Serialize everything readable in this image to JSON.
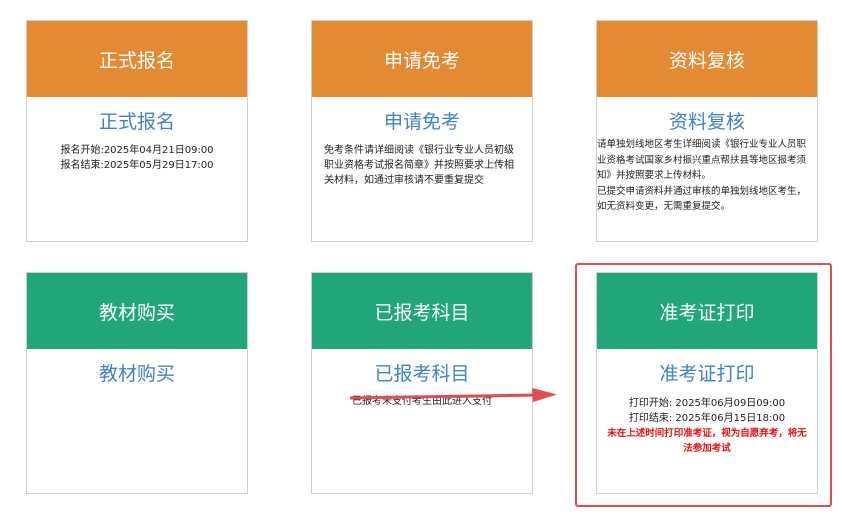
{
  "cards": {
    "formal_register": {
      "header": "正式报名",
      "link": "正式报名",
      "start": "报名开始:2025年04月21日09:00",
      "end": "报名结束:2025年05月29日17:00"
    },
    "apply_exempt": {
      "header": "申请免考",
      "link": "申请免考",
      "desc": "免考条件请详细阅读《银行业专业人员初级职业资格考试报名简章》并按照要求上传相关材料，如通过审核请不要重复提交"
    },
    "material_review": {
      "header": "资料复核",
      "link": "资料复核",
      "desc1": "请单独划线地区考生详细阅读《银行业专业人员职业资格考试国家乡村振兴重点帮扶县等地区报考须知》并按照要求上传材料。",
      "desc2": "已提交申请资料并通过审核的单独划线地区考生，如无资料变更，无需重复提交。"
    },
    "textbook_purchase": {
      "header": "教材购买",
      "link": "教材购买"
    },
    "registered_subjects": {
      "header": "已报考科目",
      "link": "已报考科目",
      "desc": "已报考未支付考生由此进入支付"
    },
    "admission_print": {
      "header": "准考证打印",
      "link": "准考证打印",
      "start": "打印开始:  2025年06月09日09:00",
      "end": "打印结束:  2025年06月15日18:00",
      "warning": "未在上述时间打印准考证，视为自愿弃考，将无法参加考试"
    }
  },
  "colors": {
    "orange_header": "#e48a33",
    "green_header": "#20a67a",
    "link_blue": "#3f83c8",
    "warning_red": "#ea1111",
    "annotation_red": "#e24c4c"
  }
}
